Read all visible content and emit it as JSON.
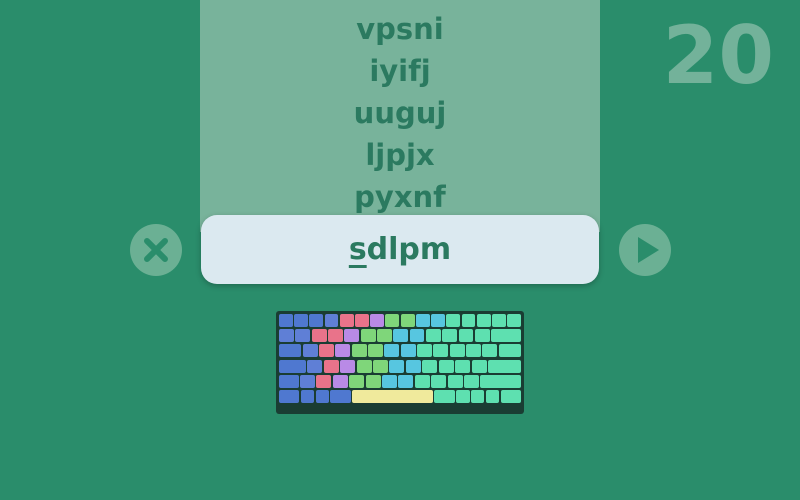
{
  "words": [
    "vpsni",
    "iyifj",
    "uuguj",
    "ljpjx",
    "pyxnf"
  ],
  "current": {
    "typed": "s",
    "remaining": "dlpm"
  },
  "score": "20",
  "buttons": {
    "clear_icon": "x-icon",
    "next_icon": "play-icon"
  },
  "colors": {
    "background": "#2a8d6b",
    "panel": "#78b39b",
    "text": "#2b7a60",
    "current_bar": "#dbe9f0",
    "round_button": "#6bb094",
    "score": "#73b29a"
  },
  "keyboard": {
    "legend_colors": {
      "pinky_left": "#5f7fd6",
      "ring_left": "#e9738a",
      "middle_left": "#b98ae6",
      "index_left": "#7fd67a",
      "index_right": "#57c6e0",
      "thumbs": "#f0ea9c",
      "modifiers": "#4f78d0",
      "right_pinky": "#5ee0b0"
    }
  }
}
